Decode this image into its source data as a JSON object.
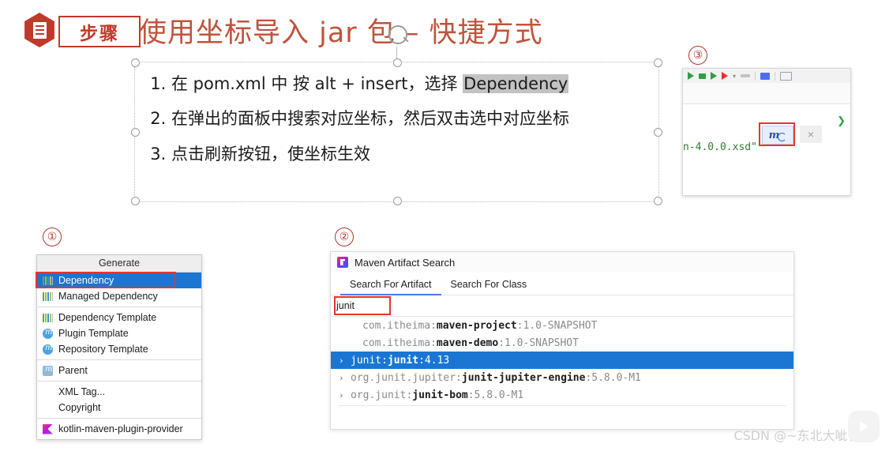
{
  "slide": {
    "badge_label": "步骤",
    "badge_icon": "document-icon",
    "title": "使用坐标导入 jar 包 – 快捷方式",
    "title_color": "#c0533c",
    "accent_color": "#c0392b"
  },
  "steps": [
    {
      "pre": "在 pom.xml 中 按 alt + insert，选择 ",
      "highlight": "Dependency"
    },
    {
      "pre": "在弹出的面板中搜索对应坐标，然后双击选中对应坐标",
      "highlight": ""
    },
    {
      "pre": "点击刷新按钮，使坐标生效",
      "highlight": ""
    }
  ],
  "markers": {
    "one": "①",
    "two": "②",
    "three": "③"
  },
  "generate_menu": {
    "header": "Generate",
    "items": [
      {
        "label": "Dependency",
        "icon": "dependency-bars-icon",
        "selected": true
      },
      {
        "label": "Managed Dependency",
        "icon": "dependency-bars-icon",
        "selected": false
      },
      {
        "label": "Dependency Template",
        "icon": "dependency-bars-icon",
        "selected": false
      },
      {
        "label": "Plugin Template",
        "icon": "maven-plugin-icon",
        "selected": false
      },
      {
        "label": "Repository Template",
        "icon": "maven-plugin-icon",
        "selected": false
      },
      {
        "label": "Parent",
        "icon": "maven-parent-icon",
        "selected": false
      },
      {
        "label": "XML Tag...",
        "icon": "",
        "selected": false
      },
      {
        "label": "Copyright",
        "icon": "",
        "selected": false
      },
      {
        "label": "kotlin-maven-plugin-provider",
        "icon": "kotlin-icon",
        "selected": false
      }
    ]
  },
  "maven_dialog": {
    "title": "Maven Artifact Search",
    "title_icon": "intellij-maven-icon",
    "tabs": [
      {
        "label": "Search For Artifact",
        "active": true
      },
      {
        "label": "Search For Class",
        "active": false
      }
    ],
    "search_value": "junit",
    "results": [
      {
        "chevron": "",
        "group": "com.itheima:",
        "artifact": "maven-project",
        "version": ":1.0-SNAPSHOT",
        "selected": false,
        "indent": true
      },
      {
        "chevron": "",
        "group": "com.itheima:",
        "artifact": "maven-demo",
        "version": ":1.0-SNAPSHOT",
        "selected": false,
        "indent": true
      },
      {
        "chevron": "›",
        "group": "junit:",
        "artifact": "junit",
        "version": ":4.13",
        "selected": true,
        "indent": false
      },
      {
        "chevron": "›",
        "group": "org.junit.jupiter:",
        "artifact": "junit-jupiter-engine",
        "version": ":5.8.0-M1",
        "selected": false,
        "indent": false
      },
      {
        "chevron": "›",
        "group": "org.junit:",
        "artifact": "junit-bom",
        "version": ":5.8.0-M1",
        "selected": false,
        "indent": false
      }
    ]
  },
  "ide_panel": {
    "code_fragment": "n-4.0.0.xsd\"",
    "refresh_button_icon": "maven-reload-icon",
    "close_icon": "×",
    "toolbar_icons": [
      "run-green-icon",
      "debug-green-icon",
      "step-over-icon",
      "stop-red-icon",
      "dropdown-caret-icon",
      "grey-bar-icon",
      "blue-chip-icon",
      "layout-icon"
    ]
  },
  "watermark": {
    "text": "CSDN @~东北大呲花 ~"
  }
}
